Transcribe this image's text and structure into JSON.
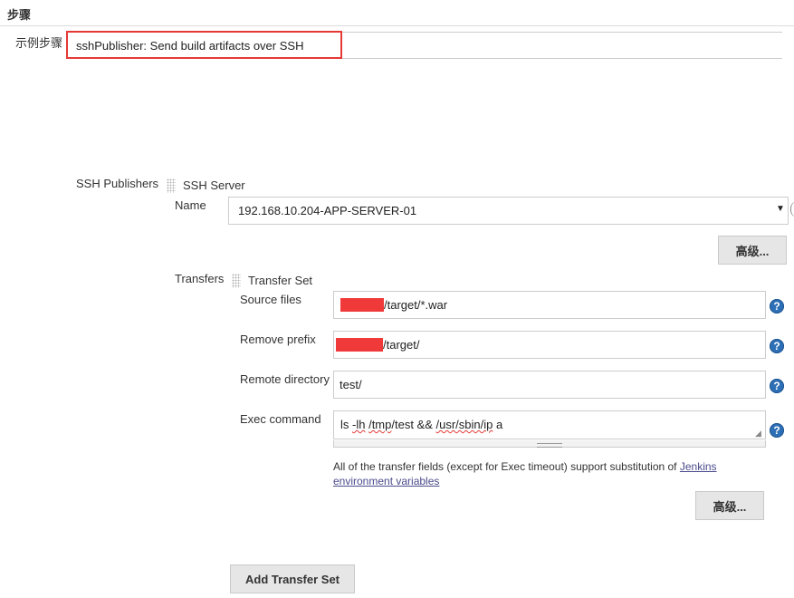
{
  "section": {
    "title": "步骤"
  },
  "sample_step": {
    "label": "示例步骤",
    "value": "sshPublisher: Send build artifacts over SSH"
  },
  "ssh_publishers": {
    "label": "SSH Publishers",
    "server_header": "SSH Server",
    "name_label": "Name",
    "name_value": "192.168.10.204-APP-SERVER-01",
    "advanced_label": "高级..."
  },
  "transfers": {
    "label": "Transfers",
    "set_header": "Transfer Set",
    "source_files": {
      "label": "Source files",
      "value": "/target/*.war"
    },
    "remove_prefix": {
      "label": "Remove prefix",
      "value": "/target/"
    },
    "remote_directory": {
      "label": "Remote directory",
      "value": "test/"
    },
    "exec_command": {
      "label": "Exec command",
      "parts": [
        "ls ",
        "-lh",
        " ",
        "/tmp",
        "/test && ",
        "/usr/sbin/ip",
        " a"
      ]
    },
    "note_text": "All of the transfer fields (except for Exec timeout) support substitution of ",
    "note_link1": "Jenkins",
    "note_link2": "environment variables",
    "advanced_label": "高级...",
    "add_button": "Add Transfer Set"
  },
  "icons": {
    "help": "help-icon",
    "grip": "drag-handle-icon",
    "dropdown": "dropdown-arrow-icon"
  },
  "colors": {
    "highlight": "#e53935",
    "redaction": "#f03a3a",
    "help": "#2d6fb6"
  }
}
